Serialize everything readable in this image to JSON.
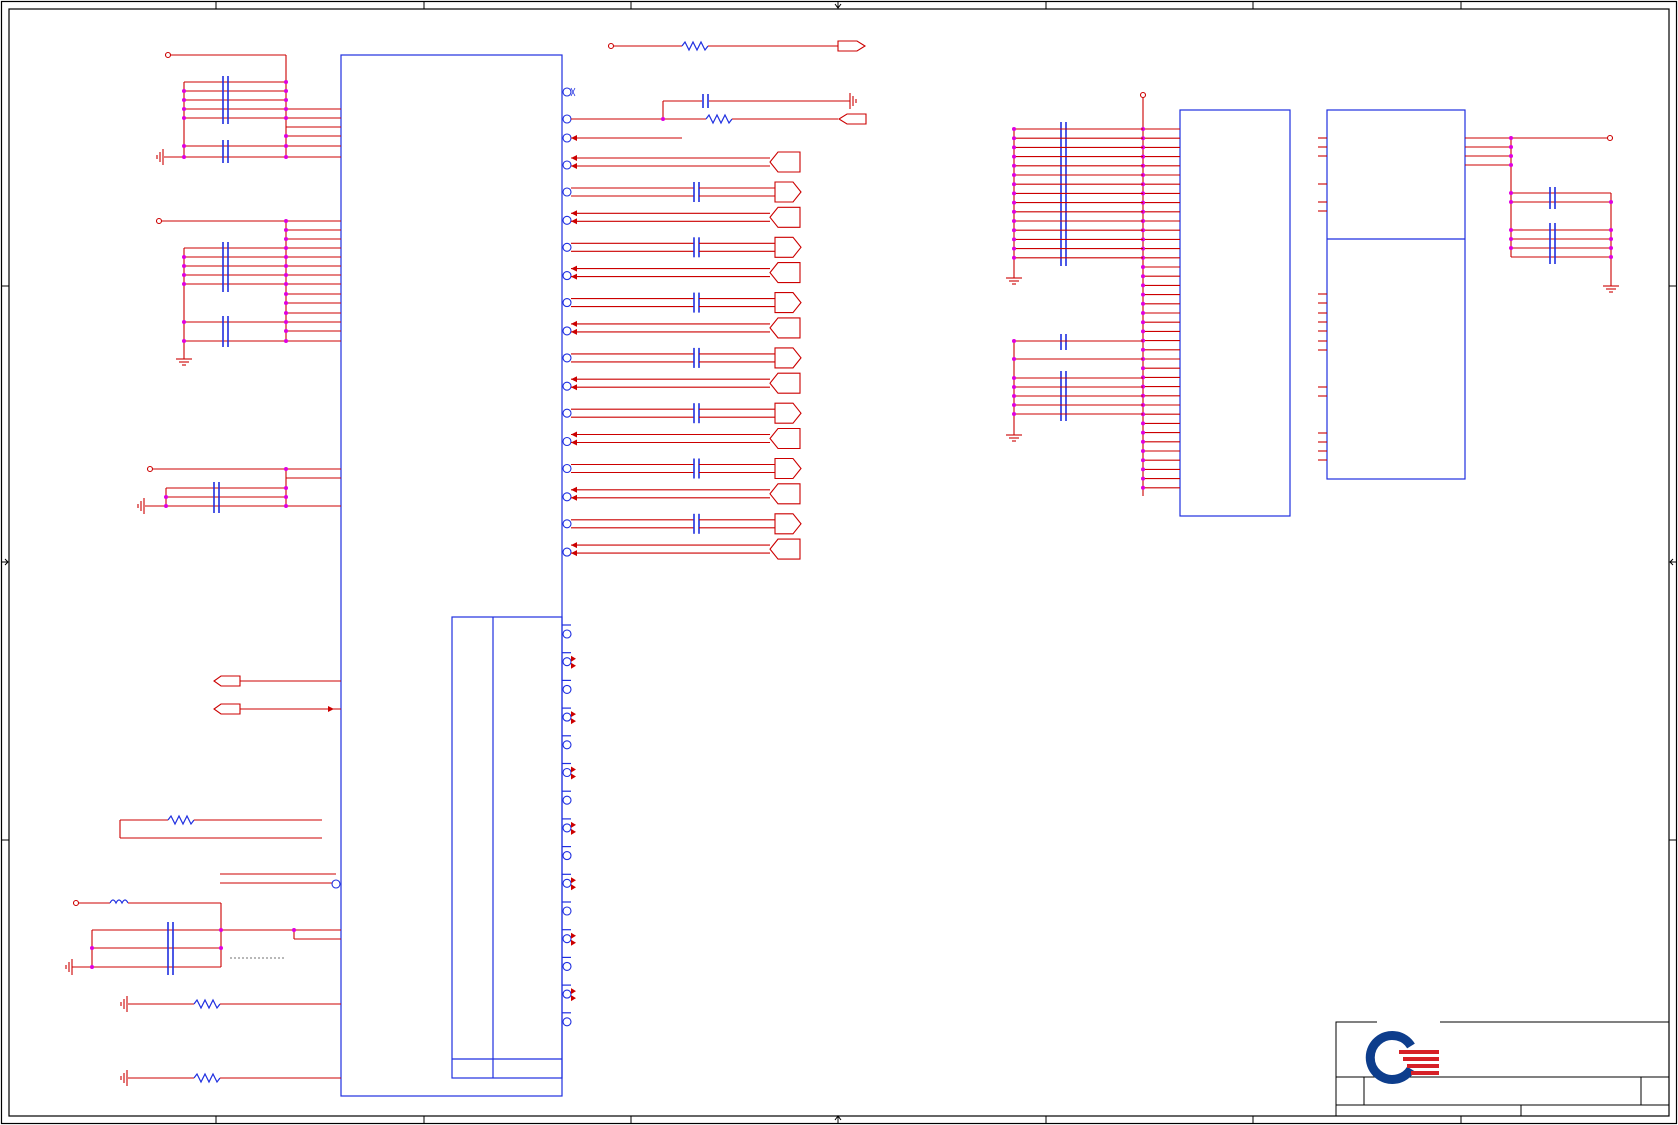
{
  "document": {
    "kind": "schematic-sheet",
    "colors": {
      "wire": "#cc0000",
      "component": "#1f2fe0",
      "junction": "#e000e0",
      "frame": "#000000",
      "logo_blue": "#0d3d8c",
      "logo_red": "#d62027"
    }
  },
  "title_block": {
    "logo": "company-logo",
    "title": "",
    "size": "",
    "document_number": "",
    "rev": "",
    "date": "",
    "sheet": ""
  }
}
